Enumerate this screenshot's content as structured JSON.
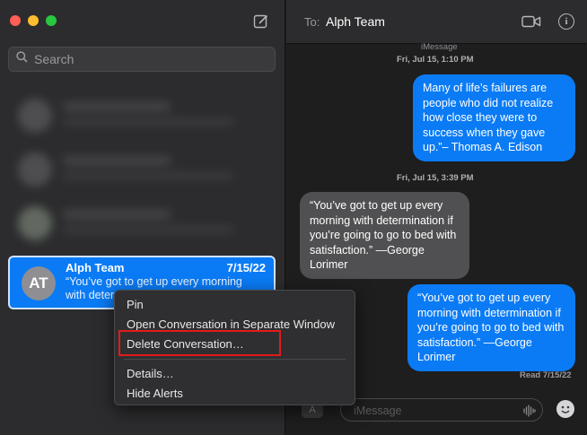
{
  "sidebar": {
    "search": {
      "placeholder": "Search"
    },
    "conversation": {
      "avatar_initials": "AT",
      "name": "Alph Team",
      "date": "7/15/22",
      "preview": "“You’ve got to get up every morning with deter"
    }
  },
  "context_menu": {
    "items": [
      "Pin",
      "Open Conversation in Separate Window",
      "Delete Conversation…",
      "Details…",
      "Hide Alerts"
    ]
  },
  "header": {
    "to_label": "To:",
    "recipient": "Alph Team"
  },
  "messages": {
    "service": "iMessage",
    "timestamp1": "Fri, Jul 15, 1:10 PM",
    "msg1": "Many of life’s failures are people who did not realize how close they were to success when they gave up.”– Thomas A. Edison",
    "timestamp2": "Fri, Jul 15, 3:39 PM",
    "msg2": "“You’ve got to get up every morning with determination if you’re going to go to bed with satisfaction.” —George Lorimer",
    "msg3": "“You’ve got to get up every morning with determination if you’re going to go to bed with satisfaction.” —George Lorimer",
    "read_receipt": "Read 7/15/22"
  },
  "composer": {
    "placeholder": "iMessage"
  },
  "icons": [
    "compose-icon",
    "search-icon",
    "video-icon",
    "info-icon",
    "app-store-icon",
    "audio-wave-icon",
    "emoji-icon"
  ],
  "colors": {
    "accent": "#0a7bf5",
    "highlight_border": "#e21b1b"
  }
}
